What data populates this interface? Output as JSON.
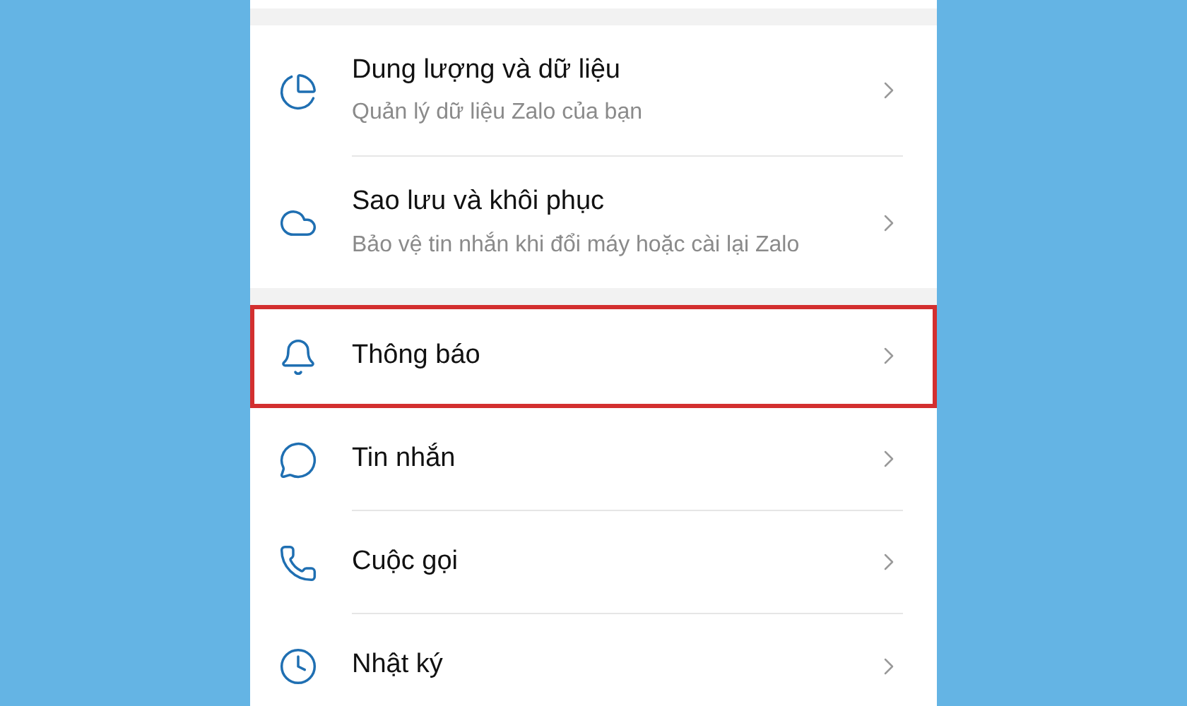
{
  "sections": [
    {
      "items": [
        {
          "kind": "storage",
          "title": "Dung lượng và dữ liệu",
          "subtitle": "Quản lý dữ liệu Zalo của bạn",
          "highlighted": false
        },
        {
          "kind": "backup",
          "title": "Sao lưu và khôi phục",
          "subtitle": "Bảo vệ tin nhắn khi đổi máy hoặc cài lại Zalo",
          "highlighted": false
        }
      ]
    },
    {
      "items": [
        {
          "kind": "notifications",
          "title": "Thông báo",
          "highlighted": true
        },
        {
          "kind": "messages",
          "title": "Tin nhắn",
          "highlighted": false
        },
        {
          "kind": "calls",
          "title": "Cuộc gọi",
          "highlighted": false
        },
        {
          "kind": "diary",
          "title": "Nhật ký",
          "highlighted": false
        }
      ]
    }
  ]
}
